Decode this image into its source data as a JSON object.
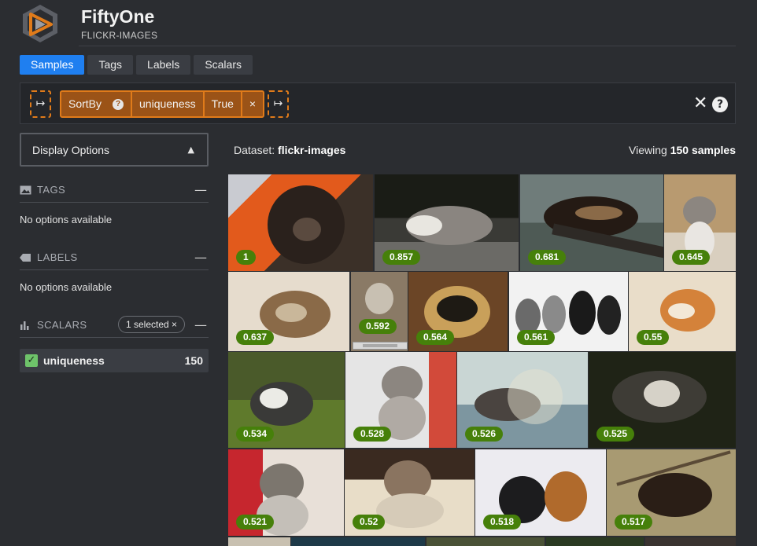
{
  "header": {
    "app_title": "FiftyOne",
    "dataset_label": "FLICKR-IMAGES"
  },
  "tabs": [
    {
      "label": "Samples",
      "active": true
    },
    {
      "label": "Tags",
      "active": false
    },
    {
      "label": "Labels",
      "active": false
    },
    {
      "label": "Scalars",
      "active": false
    }
  ],
  "view_bar": {
    "stage": {
      "name": "SortBy",
      "field": "uniqueness",
      "reverse": "True",
      "remove": "×"
    },
    "add_stage_glyph": "↦",
    "clear_glyph": "✕",
    "help_glyph": "?"
  },
  "sidebar": {
    "display_options": "Display Options",
    "tags": {
      "title": "TAGS",
      "empty": "No options available",
      "collapse": "—"
    },
    "labels": {
      "title": "LABELS",
      "empty": "No options available",
      "collapse": "—"
    },
    "scalars": {
      "title": "SCALARS",
      "selected": "1 selected ×",
      "collapse": "—"
    },
    "field": {
      "name": "uniqueness",
      "count": "150",
      "checked": true
    }
  },
  "main": {
    "dataset_prefix": "Dataset:",
    "dataset_name": "flickr-images",
    "viewing_prefix": "Viewing",
    "viewing_count": "150 samples"
  },
  "samples": [
    {
      "score": "1",
      "subject": "wolverine-face"
    },
    {
      "score": "0.857",
      "subject": "badger"
    },
    {
      "score": "0.681",
      "subject": "wolverine-on-log"
    },
    {
      "score": "0.645",
      "subject": "kitten"
    },
    {
      "score": "0.637",
      "subject": "sleeping-kitten"
    },
    {
      "score": "0.592",
      "subject": "kitten-screenshot"
    },
    {
      "score": "0.564",
      "subject": "honey-badger"
    },
    {
      "score": "0.561",
      "subject": "four-kittens"
    },
    {
      "score": "0.55",
      "subject": "ginger-kitten"
    },
    {
      "score": "0.534",
      "subject": "badger-grass"
    },
    {
      "score": "0.528",
      "subject": "tabby-kitten"
    },
    {
      "score": "0.526",
      "subject": "badger-painting"
    },
    {
      "score": "0.525",
      "subject": "badger-night"
    },
    {
      "score": "0.521",
      "subject": "kitten-red"
    },
    {
      "score": "0.52",
      "subject": "kitten-lying"
    },
    {
      "score": "0.518",
      "subject": "kittens-pair"
    },
    {
      "score": "0.517",
      "subject": "wolverine-branch"
    }
  ],
  "colors": {
    "accent": "#1f7ff0",
    "stage_orange": "#e07b1a",
    "badge_green": "#46800a",
    "background": "#2b2d31"
  }
}
